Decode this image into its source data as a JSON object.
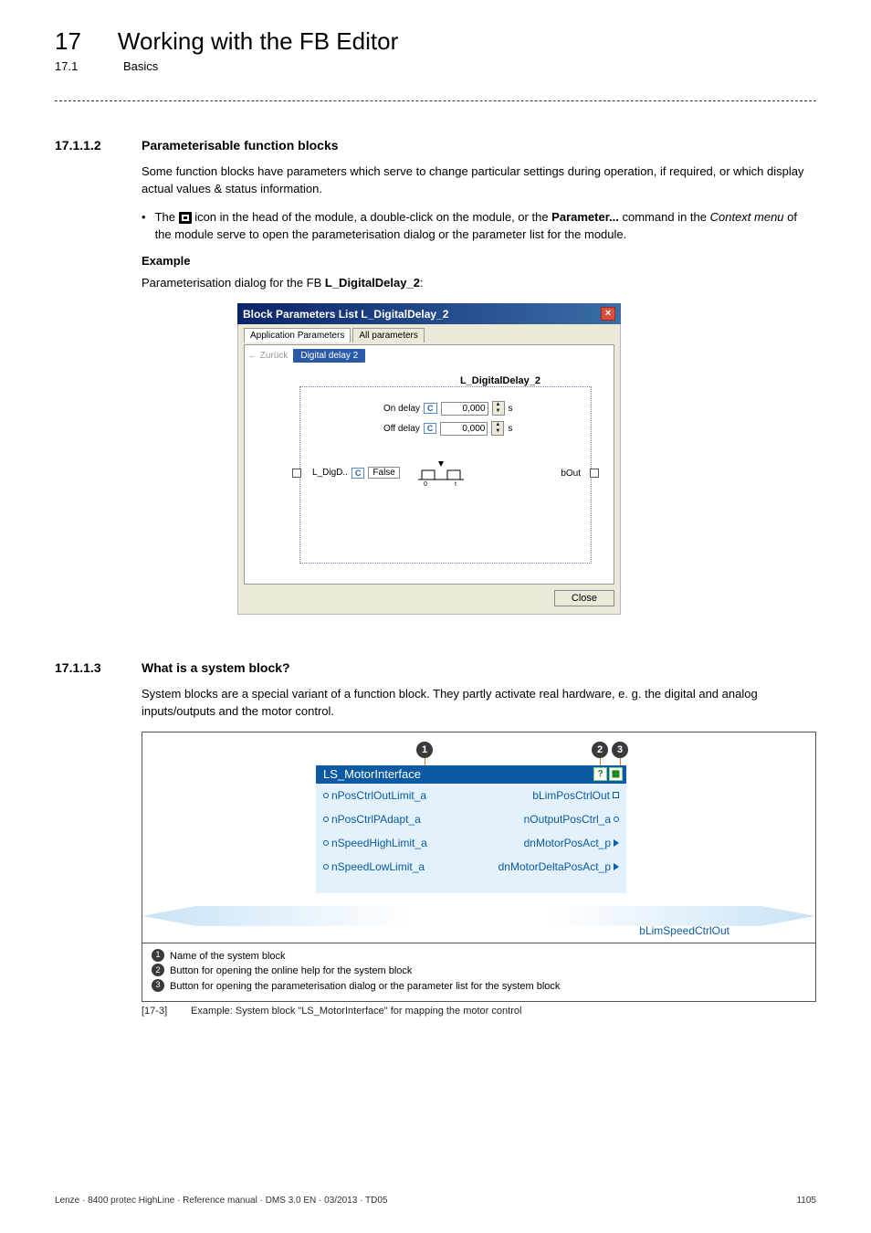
{
  "chapter": {
    "num": "17",
    "title": "Working with the FB Editor",
    "subnum": "17.1",
    "subtitle": "Basics"
  },
  "sec1": {
    "num": "17.1.1.2",
    "title": "Parameterisable function blocks",
    "intro": "Some function blocks have parameters which serve to change particular settings during operation, if required, or which display actual values & status information.",
    "bullet_pre": "The ",
    "bullet_mid1": " icon in the head of the module, a double-click on the module, or the ",
    "bullet_param": "Parameter...",
    "bullet_mid2": " command in the ",
    "bullet_ctx": "Context menu",
    "bullet_post": " of the module serve to open the parameterisation dialog or the parameter list for the module.",
    "example_hdr": "Example",
    "example_pre": "Parameterisation dialog for the FB ",
    "example_fb": "L_DigitalDelay_2",
    "example_post": ":"
  },
  "dialog": {
    "title": "Block Parameters List L_DigitalDelay_2",
    "tab1": "Application Parameters",
    "tab2": "All parameters",
    "back": "← Zurück",
    "crumb": "Digital delay 2",
    "blk_name": "L_DigitalDelay_2",
    "on_label": "On delay",
    "off_label": "Off delay",
    "on_val": "0,000",
    "off_val": "0,000",
    "unit": "s",
    "in_label": "L_DigD..",
    "in_val": "False",
    "out_label": "bOut",
    "axis0": "0",
    "axist": "t",
    "close": "Close"
  },
  "sec2": {
    "num": "17.1.1.3",
    "title": "What is a system block?",
    "intro": "System blocks are a special variant of a function block. They partly activate real hardware, e. g. the digital and analog inputs/outputs and the motor control."
  },
  "sysblock": {
    "header": "LS_MotorInterface",
    "rows": [
      {
        "l": "nPosCtrlOutLimit_a",
        "r": "bLimPosCtrlOut",
        "rt": "sq"
      },
      {
        "l": "nPosCtrlPAdapt_a",
        "r": "nOutputPosCtrl_a",
        "rt": "dot"
      },
      {
        "l": "nSpeedHighLimit_a",
        "r": "dnMotorPosAct_p",
        "rt": "tri"
      },
      {
        "l": "nSpeedLowLimit_a",
        "r": "dnMotorDeltaPosAct_p",
        "rt": "tri"
      }
    ],
    "cut": "bLimSpeedCtrlOut",
    "legend1": "Name of the system block",
    "legend2": "Button for opening the online help for the system block",
    "legend3": "Button for opening the parameterisation dialog or the parameter list for the system block"
  },
  "caption": {
    "tag": "[17-3]",
    "text": "Example: System block \"LS_MotorInterface\" for mapping the motor control"
  },
  "footer": {
    "left": "Lenze · 8400 protec HighLine · Reference manual · DMS 3.0 EN · 03/2013 · TD05",
    "right": "1105"
  }
}
